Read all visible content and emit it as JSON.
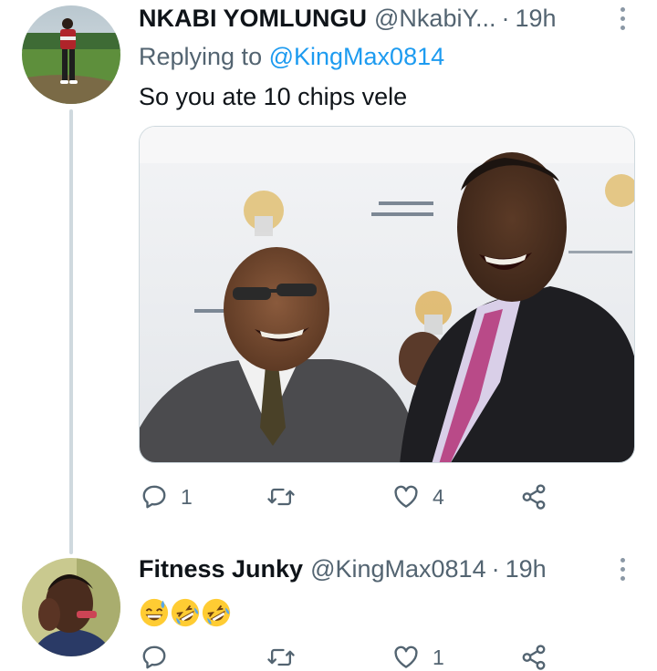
{
  "tweets": [
    {
      "display_name": "NKABI YOMLUNGU",
      "handle": "@NkabiY...",
      "separator": "·",
      "time": "19h",
      "replying_prefix": "Replying to ",
      "replying_to": "@KingMax0814",
      "text": "So you ate 10 chips vele",
      "media_alt": "Two men in suits laughing",
      "actions": {
        "replies": "1",
        "retweets": "",
        "likes": "4"
      },
      "icons": [
        "reply-icon",
        "retweet-icon",
        "like-icon",
        "share-icon",
        "more-icon"
      ]
    },
    {
      "display_name": "Fitness Junky",
      "handle": "@KingMax0814",
      "separator": "·",
      "time": "19h",
      "emojis": [
        "grinning-sweat-emoji",
        "rolling-laughing-emoji",
        "rolling-laughing-emoji"
      ],
      "actions": {
        "replies": "",
        "retweets": "",
        "likes": "1"
      },
      "icons": [
        "reply-icon",
        "retweet-icon",
        "like-icon",
        "share-icon",
        "more-icon"
      ]
    }
  ],
  "colors": {
    "link": "#1d9bf0",
    "secondary_text": "#536471",
    "primary_text": "#0f1419",
    "thread_line": "#cfd9de"
  }
}
